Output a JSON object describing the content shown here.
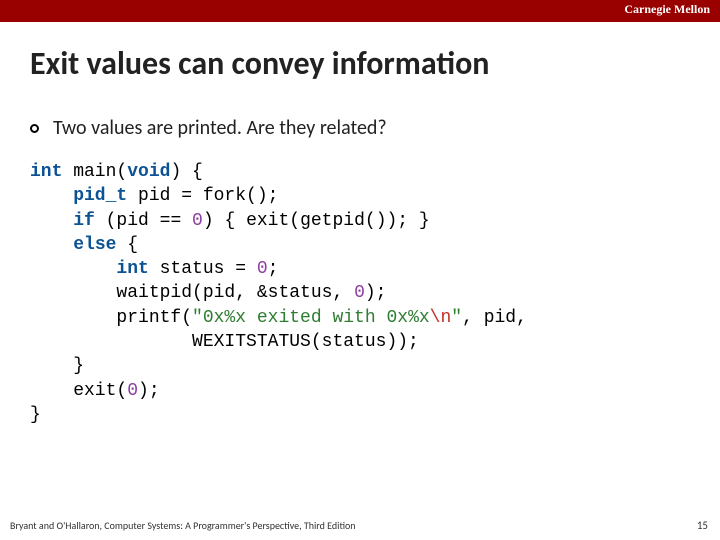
{
  "brand": "Carnegie Mellon",
  "title": "Exit values can convey information",
  "bullet": "Two values are printed. Are they related?",
  "code": {
    "l1a": "int",
    "l1b": " main(",
    "l1c": "void",
    "l1d": ") {",
    "l2a": "    pid_t",
    "l2b": " pid = fork();",
    "l3a": "    ",
    "l3b": "if",
    "l3c": " (pid == ",
    "l3d": "0",
    "l3e": ") { exit(getpid()); }",
    "l4a": "    ",
    "l4b": "else",
    "l4c": " {",
    "l5a": "        ",
    "l5b": "int",
    "l5c": " status = ",
    "l5d": "0",
    "l5e": ";",
    "l6a": "        waitpid(pid, &status, ",
    "l6b": "0",
    "l6c": ");",
    "l7a": "        printf(",
    "l7b": "\"0x%x exited with 0x%x",
    "l7c": "\\n",
    "l7d": "\"",
    "l7e": ", pid,",
    "l8": "               WEXITSTATUS(status));",
    "l9": "    }",
    "l10a": "    exit(",
    "l10b": "0",
    "l10c": ");",
    "l11": "}"
  },
  "footer": "Bryant and O'Hallaron, Computer Systems: A Programmer's Perspective, Third Edition",
  "pagenum": "15"
}
